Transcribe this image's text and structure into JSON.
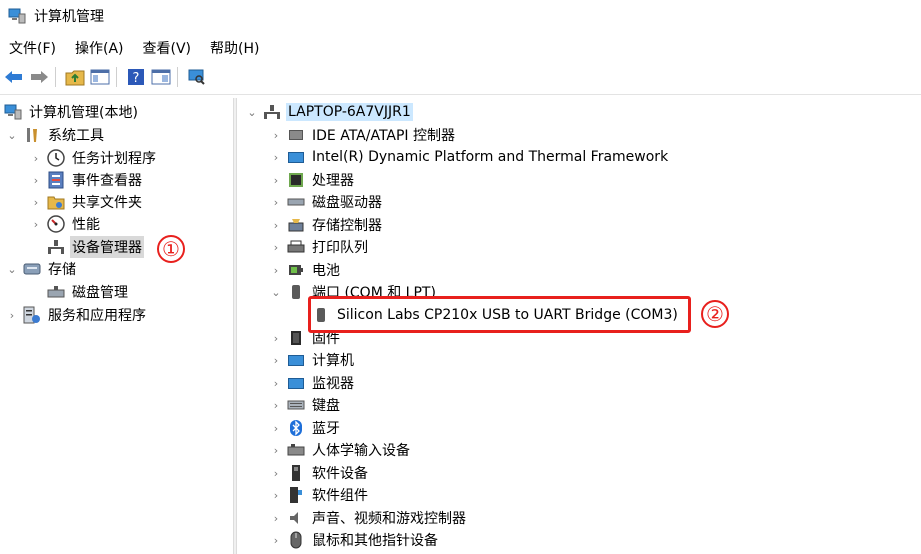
{
  "window": {
    "title": "计算机管理"
  },
  "menu": [
    "文件(F)",
    "操作(A)",
    "查看(V)",
    "帮助(H)"
  ],
  "left_tree": {
    "root": "计算机管理(本地)",
    "system_tools": "系统工具",
    "task_scheduler": "任务计划程序",
    "event_viewer": "事件查看器",
    "shared_folders": "共享文件夹",
    "performance": "性能",
    "device_manager": "设备管理器",
    "storage": "存储",
    "disk_management": "磁盘管理",
    "services_apps": "服务和应用程序"
  },
  "device_tree": {
    "computer": "LAPTOP-6A7VJJR1",
    "categories": [
      "IDE ATA/ATAPI 控制器",
      "Intel(R) Dynamic Platform and Thermal Framework",
      "处理器",
      "磁盘驱动器",
      "存储控制器",
      "打印队列",
      "电池",
      "端口 (COM 和 LPT)",
      "固件",
      "计算机",
      "监视器",
      "键盘",
      "蓝牙",
      "人体学输入设备",
      "软件设备",
      "软件组件",
      "声音、视频和游戏控制器",
      "鼠标和其他指针设备"
    ],
    "port_device": "Silicon Labs CP210x USB to UART Bridge (COM3)"
  },
  "annotations": {
    "step1": "①",
    "step2": "②"
  },
  "colors": {
    "annotation_red": "#e8201d",
    "selection_gray": "#d9d9d9",
    "highlight_blue": "#cce8ff"
  }
}
